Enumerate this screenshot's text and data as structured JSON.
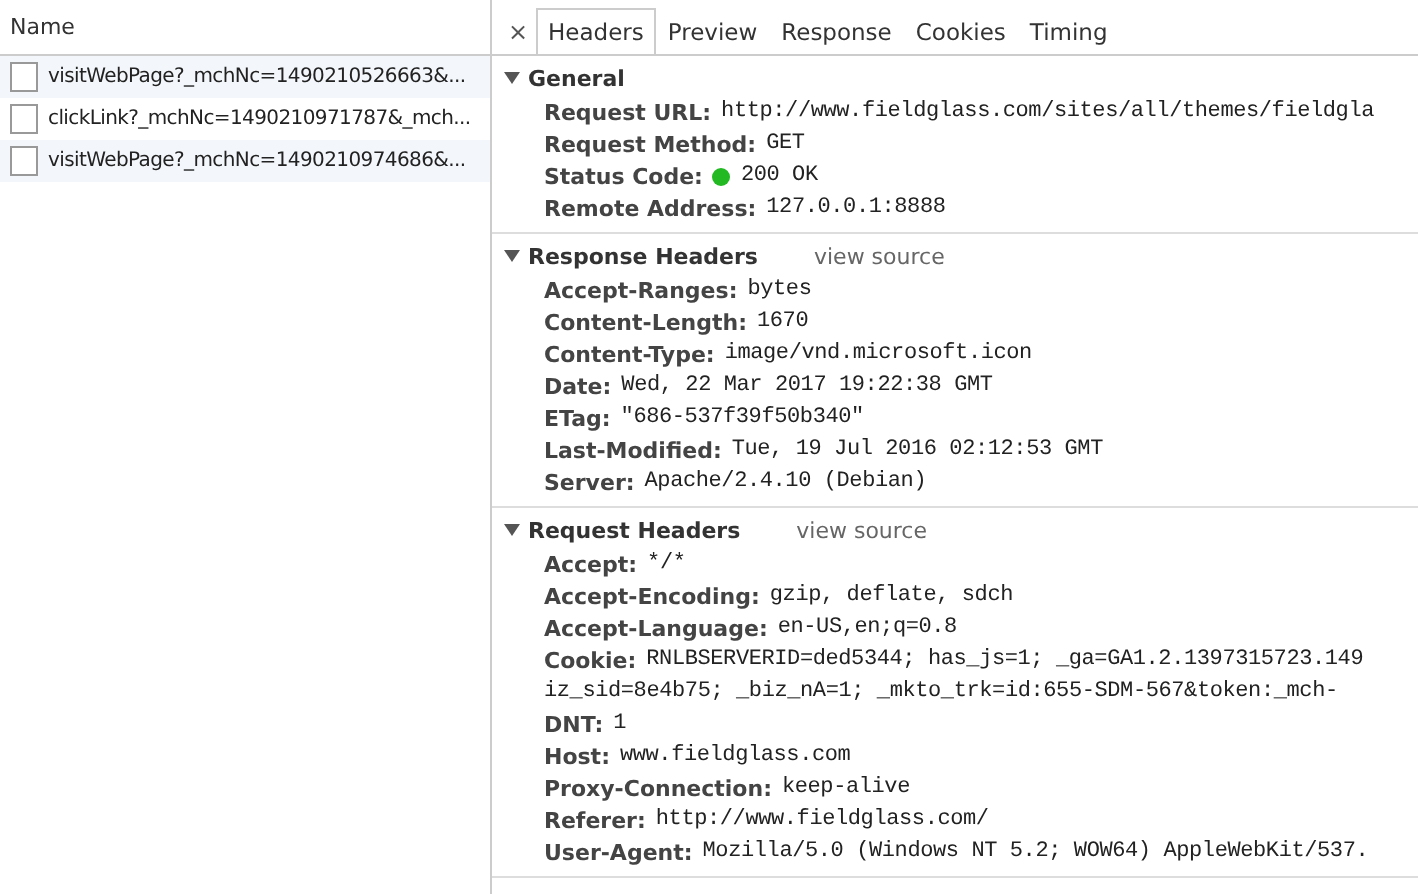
{
  "requests": {
    "column": "Name",
    "rows": [
      {
        "name": "visitWebPage?_mchNc=1490210526663&..."
      },
      {
        "name": "clickLink?_mchNc=1490210971787&_mch..."
      },
      {
        "name": "visitWebPage?_mchNc=1490210974686&..."
      }
    ]
  },
  "close": "×",
  "tabs": [
    {
      "label": "Headers",
      "selected": true
    },
    {
      "label": "Preview",
      "selected": false
    },
    {
      "label": "Response",
      "selected": false
    },
    {
      "label": "Cookies",
      "selected": false
    },
    {
      "label": "Timing",
      "selected": false
    }
  ],
  "sections": [
    {
      "title": "General",
      "expanded": true,
      "headers": [
        {
          "name": "Request URL:",
          "value": "http://www.fieldglass.com/sites/all/themes/fieldgla"
        },
        {
          "name": "Request Method:",
          "value": "GET"
        },
        {
          "name": "Status Code:",
          "value": "200 OK",
          "color": "#22b922"
        },
        {
          "name": "Remote Address:",
          "value": "127.0.0.1:8888"
        }
      ]
    },
    {
      "title": "Response Headers",
      "link": "view source",
      "expanded": true,
      "headers": [
        {
          "name": "Accept-Ranges:",
          "value": "bytes"
        },
        {
          "name": "Content-Length:",
          "value": "1670"
        },
        {
          "name": "Content-Type:",
          "value": "image/vnd.microsoft.icon"
        },
        {
          "name": "Date:",
          "value": "Wed, 22 Mar 2017 19:22:38 GMT"
        },
        {
          "name": "ETag:",
          "value": "\"686-537f39f50b340\""
        },
        {
          "name": "Last-Modified:",
          "value": "Tue, 19 Jul 2016 02:12:53 GMT"
        },
        {
          "name": "Server:",
          "value": "Apache/2.4.10 (Debian)"
        }
      ]
    },
    {
      "title": "Request Headers",
      "link": "view source",
      "expanded": true,
      "headers": [
        {
          "name": "Accept:",
          "value": "*/*"
        },
        {
          "name": "Accept-Encoding:",
          "value": "gzip, deflate, sdch"
        },
        {
          "name": "Accept-Language:",
          "value": "en-US,en;q=0.8"
        },
        {
          "name": "Cookie:",
          "value": "RNLBSERVERID=ded5344; has_js=1; _ga=GA1.2.1397315723.149",
          "continuation": "iz_sid=8e4b75; _biz_nA=1; _mkto_trk=id:655-SDM-567&token:_mch-"
        },
        {
          "name": "DNT:",
          "value": "1"
        },
        {
          "name": "Host:",
          "value": "www.fieldglass.com"
        },
        {
          "name": "Proxy-Connection:",
          "value": "keep-alive"
        },
        {
          "name": "Referer:",
          "value": "http://www.fieldglass.com/"
        },
        {
          "name": "User-Agent:",
          "value": "Mozilla/5.0 (Windows NT 5.2; WOW64) AppleWebKit/537."
        }
      ]
    }
  ]
}
